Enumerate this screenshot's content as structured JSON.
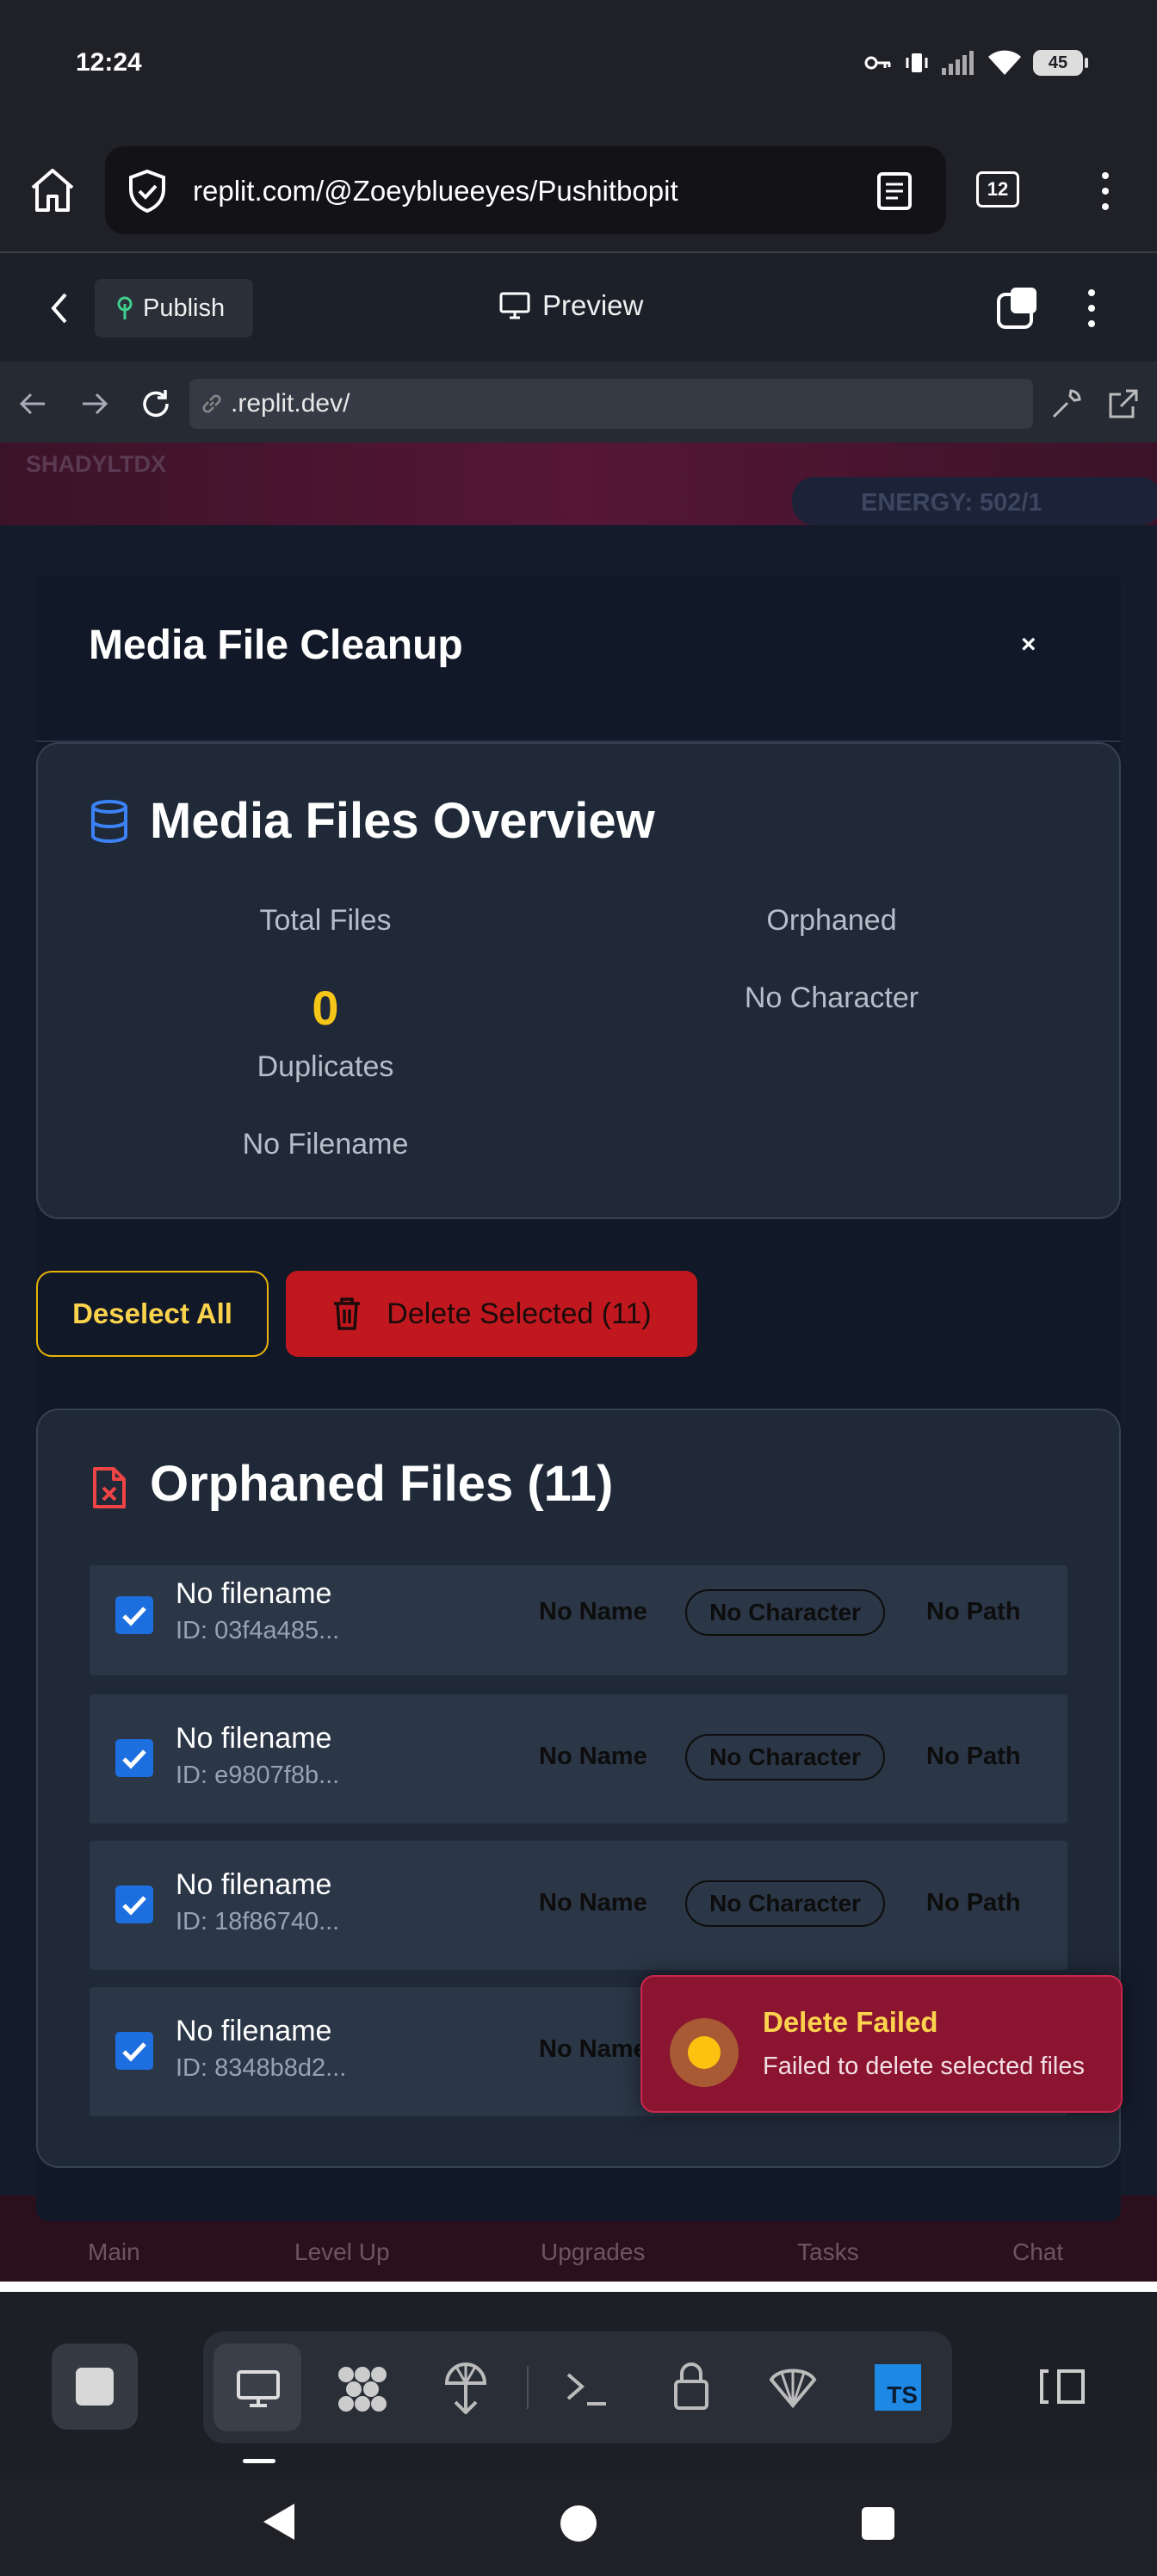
{
  "status_bar": {
    "time": "12:24",
    "battery": "45"
  },
  "browser": {
    "url": "replit.com/@Zoeyblueeyes/Pushitbopit",
    "tab_count": "12"
  },
  "replit_bar": {
    "publish_label": "Publish",
    "preview_label": "Preview"
  },
  "webview": {
    "url": ".replit.dev/"
  },
  "app_background": {
    "brand": "SHADYLTDX",
    "energy": "ENERGY: 502/1",
    "nav": [
      "Main",
      "Level Up",
      "Upgrades",
      "Tasks",
      "Chat"
    ]
  },
  "modal": {
    "title": "Media File Cleanup",
    "close": "×",
    "overview": {
      "title": "Media Files Overview",
      "total_files_label": "Total Files",
      "total_files_value": "0",
      "duplicates_label": "Duplicates",
      "no_filename_label": "No Filename",
      "orphaned_label": "Orphaned",
      "no_character_label": "No Character"
    },
    "actions": {
      "deselect_all": "Deselect All",
      "delete_selected": "Delete Selected (11)"
    },
    "orphaned": {
      "title": "Orphaned Files (11)",
      "rows": [
        {
          "filename": "No filename",
          "id": "ID: 03f4a485...",
          "name": "No Name",
          "character": "No Character",
          "path": "No Path",
          "checked": true
        },
        {
          "filename": "No filename",
          "id": "ID: e9807f8b...",
          "name": "No Name",
          "character": "No Character",
          "path": "No Path",
          "checked": true
        },
        {
          "filename": "No filename",
          "id": "ID: 18f86740...",
          "name": "No Name",
          "character": "No Character",
          "path": "No Path",
          "checked": true
        },
        {
          "filename": "No filename",
          "id": "ID: 8348b8d2...",
          "name": "No Name",
          "checked": true
        }
      ]
    }
  },
  "toast": {
    "title": "Delete Failed",
    "message": "Failed to delete selected files"
  },
  "colors": {
    "accent_yellow": "#f5c518",
    "danger_red": "#c0181e",
    "checkbox_blue": "#1d6fe0",
    "toast_bg": "#8b1430"
  }
}
